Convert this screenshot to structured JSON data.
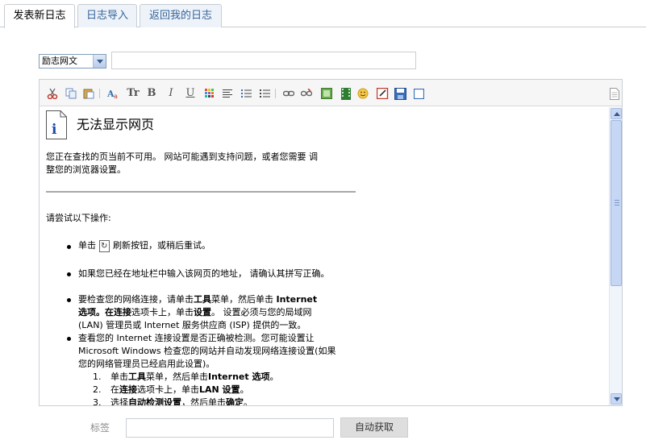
{
  "tabs": [
    {
      "label": "发表新日志"
    },
    {
      "label": "日志导入"
    },
    {
      "label": "返回我的日志"
    }
  ],
  "category": {
    "selected": "励志网文"
  },
  "title_input": {
    "value": ""
  },
  "editor": {
    "error_title": "无法显示网页",
    "intro_line1": "您正在查找的页当前不可用。 网站可能遇到支持问题，或者您需要 调",
    "intro_line2": "整您的浏览器设置。",
    "try_heading": "请尝试以下操作:",
    "bullet1_pre": "单击",
    "bullet1_post": "刷新按钮，或稍后重试。",
    "bullet2": "如果您已经在地址栏中输入该网页的地址， 请确认其拼写正确。",
    "bullet3_line1a": "要检查您的网络连接，请单击",
    "bullet3_line1b": "工具",
    "bullet3_line1c": "菜单，然后单击",
    "bullet3_line1d": "Internet",
    "bullet3_line2a": "选项",
    "bullet3_line2b": "。在",
    "bullet3_line2c": "连接",
    "bullet3_line2d": "选项卡上，单击",
    "bullet3_line2e": "设置",
    "bullet3_line2f": "。 设置必须与您的局域网",
    "bullet3_line3": "(LAN) 管理员或 Internet 服务供应商 (ISP) 提供的一致。",
    "bullet4_line1": "查看您的 Internet 连接设置是否正确被检测。您可能设置让",
    "bullet4_line2": "Microsoft Windows 检查您的网站并自动发现网络连接设置(如果",
    "bullet4_line3": "您的网络管理员已经启用此设置)。",
    "step1_num": "1.",
    "step1a": "单击",
    "step1b": "工具",
    "step1c": "菜单，然后单击",
    "step1d": "Internet 选项",
    "step1e": "。",
    "step2_num": "2.",
    "step2a": "在",
    "step2b": "连接",
    "step2c": "选项卡上，单击",
    "step2d": "LAN 设置",
    "step2e": "。",
    "step3_num": "3.",
    "step3a": "选择",
    "step3b": "自动检测设置",
    "step3c": "，然后单击",
    "step3d": "确定",
    "step3e": "。"
  },
  "tags": {
    "label": "标签",
    "value": "",
    "auto_button": "自动获取"
  },
  "toolbar_icons": [
    "cut-icon",
    "copy-icon",
    "paste-icon",
    "font-icon",
    "font-size-icon",
    "bold-icon",
    "italic-icon",
    "underline-icon",
    "color-icon",
    "align-icon",
    "unordered-list-icon",
    "ordered-list-icon",
    "link-icon",
    "unlink-icon",
    "image-icon",
    "media-icon",
    "emoticon-icon",
    "edit-icon",
    "save-icon",
    "html-source-icon",
    "fullscreen-icon"
  ]
}
